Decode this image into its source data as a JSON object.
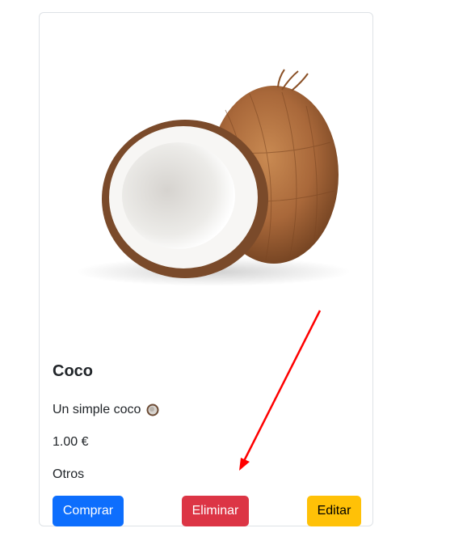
{
  "product": {
    "title": "Coco",
    "description": "Un simple coco",
    "description_icon": "coconut-emoji-icon",
    "price": "1.00 €",
    "category": "Otros",
    "image": "coconut-image"
  },
  "actions": {
    "buy_label": "Comprar",
    "delete_label": "Eliminar",
    "edit_label": "Editar"
  },
  "colors": {
    "primary": "#0d6efd",
    "danger": "#dc3545",
    "warning": "#ffc107",
    "annotation_arrow": "#ff0000"
  }
}
